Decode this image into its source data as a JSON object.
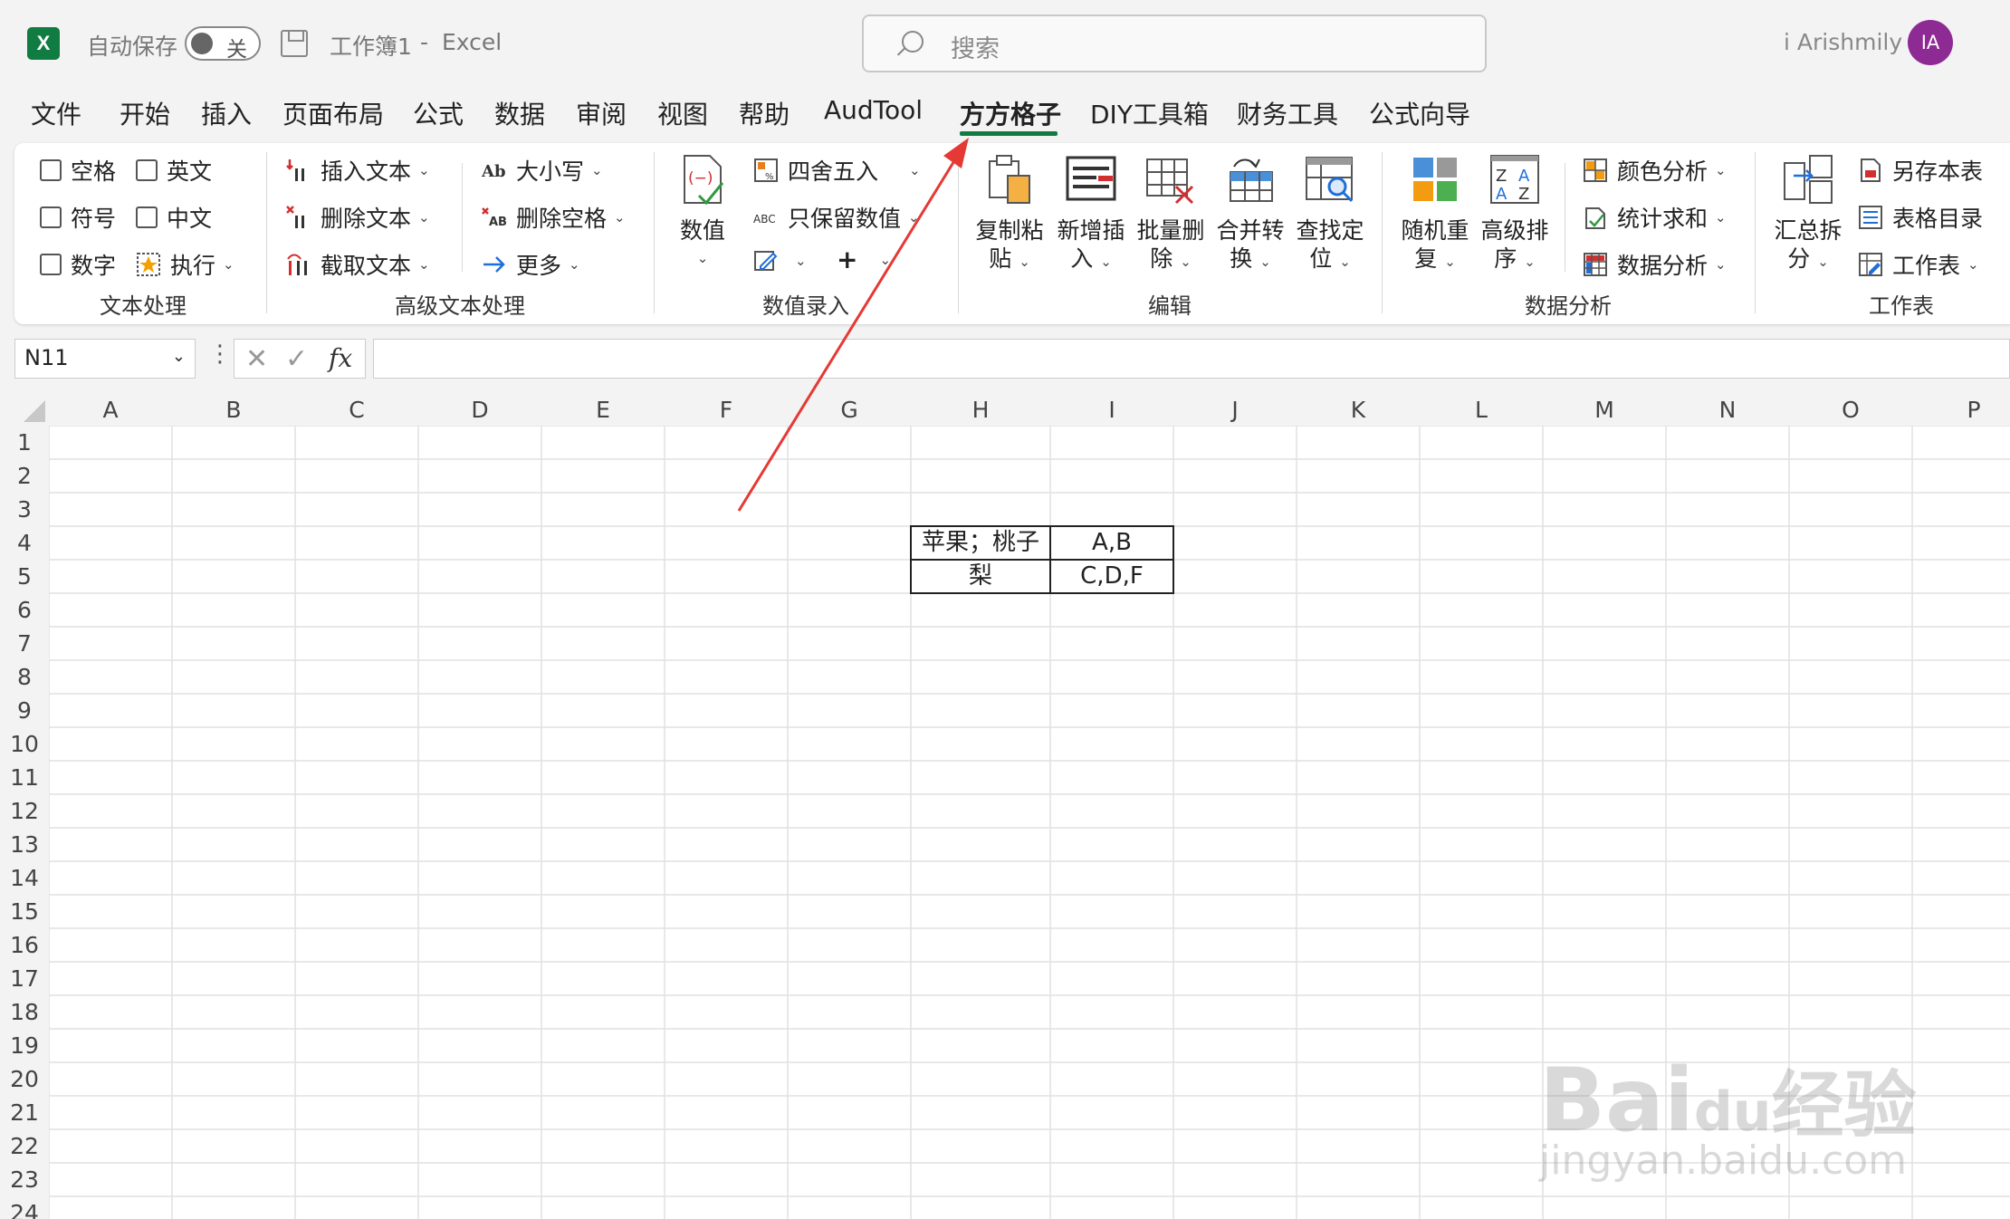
{
  "title_bar": {
    "app_icon": "excel-logo",
    "app_letter": "X",
    "autosave_label": "自动保存",
    "autosave_state": "关",
    "workbook": "工作簿1",
    "separator": "-",
    "app_name": "Excel",
    "search_placeholder": "搜索",
    "user_name": "i Arishmily",
    "user_initials": "IA",
    "avatar_color": "#8e2a94"
  },
  "tabs": [
    {
      "label": "文件"
    },
    {
      "label": "开始"
    },
    {
      "label": "插入"
    },
    {
      "label": "页面布局"
    },
    {
      "label": "公式"
    },
    {
      "label": "数据"
    },
    {
      "label": "审阅"
    },
    {
      "label": "视图"
    },
    {
      "label": "帮助"
    },
    {
      "label": "AudTool"
    },
    {
      "label": "方方格子",
      "active": true
    },
    {
      "label": "DIY工具箱"
    },
    {
      "label": "财务工具"
    },
    {
      "label": "公式向导"
    }
  ],
  "ribbon": {
    "text_processing": {
      "label": "文本处理",
      "checks": [
        "空格",
        "英文",
        "符号",
        "中文",
        "数字"
      ],
      "execute": "执行"
    },
    "advanced_text": {
      "label": "高级文本处理",
      "items": [
        "插入文本",
        "删除文本",
        "截取文本",
        "大小写",
        "删除空格",
        "更多"
      ]
    },
    "number_entry": {
      "label": "数值录入",
      "big": "数值",
      "round": "四舍五入",
      "keep_numbers": "只保留数值",
      "plus": "+"
    },
    "edit": {
      "label": "编辑",
      "buttons": [
        {
          "l1": "复制粘",
          "l2": "贴"
        },
        {
          "l1": "新增插",
          "l2": "入"
        },
        {
          "l1": "批量删",
          "l2": "除"
        },
        {
          "l1": "合并转",
          "l2": "换"
        },
        {
          "l1": "查找定",
          "l2": "位"
        }
      ]
    },
    "data_analysis": {
      "label": "数据分析",
      "buttons": [
        {
          "l1": "随机重",
          "l2": "复"
        },
        {
          "l1": "高级排",
          "l2": "序"
        }
      ],
      "items": [
        "颜色分析",
        "统计求和",
        "数据分析"
      ]
    },
    "worksheet": {
      "label": "工作表",
      "big_l1": "汇总拆",
      "big_l2": "分",
      "items": [
        "另存本表",
        "表格目录",
        "工作表"
      ]
    }
  },
  "formula_bar": {
    "name_box": "N11",
    "fx_label": "fx",
    "formula": ""
  },
  "grid": {
    "columns": [
      "A",
      "B",
      "C",
      "D",
      "E",
      "F",
      "G",
      "H",
      "I",
      "J",
      "K",
      "L",
      "M",
      "N",
      "O",
      "P"
    ],
    "rows": [
      "1",
      "2",
      "3",
      "4",
      "5",
      "6",
      "7",
      "8",
      "9",
      "10",
      "11",
      "12",
      "13",
      "14",
      "15",
      "16",
      "17",
      "18",
      "19",
      "20",
      "21",
      "22",
      "23",
      "24"
    ],
    "cells": {
      "H4": "苹果；桃子",
      "I4": "A,B",
      "H5": "梨",
      "I5": "C,D,F"
    }
  },
  "annotation": {
    "arrow_color": "#e53935"
  },
  "watermark": {
    "brand": "Bai",
    "brand2": "du",
    "brand_cn": "经验",
    "url": "jingyan.baidu.com"
  }
}
